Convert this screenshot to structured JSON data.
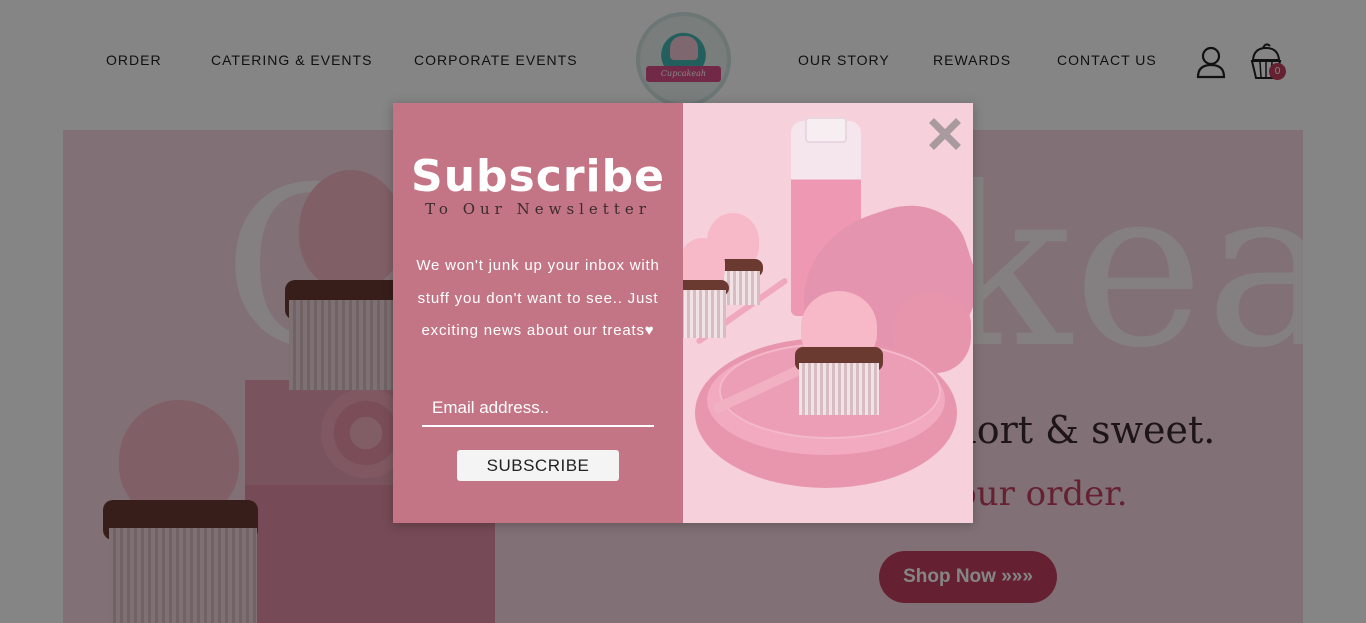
{
  "nav": {
    "left": [
      "ORDER",
      "CATERING & EVENTS",
      "CORPORATE EVENTS"
    ],
    "right": [
      "OUR STORY",
      "REWARDS",
      "CONTACT US"
    ]
  },
  "logo": {
    "ribbon_text": "Cupcakeah"
  },
  "cart": {
    "count": "0"
  },
  "hero": {
    "bg_text": "Cupcakeah",
    "tagline": "Life is short & sweet.",
    "subline": "Place your order.",
    "cta_label": "Shop Now »»»"
  },
  "modal": {
    "title": "Subscribe",
    "subtitle": "To Our Newsletter",
    "body": "We won't junk up your inbox with stuff you don't want to see.. Just exciting news about our treats♥",
    "email_placeholder": "Email address..",
    "button_label": "SUBSCRIBE"
  },
  "colors": {
    "accent": "#c2405e",
    "modal_panel": "#c47585",
    "overlay": "rgba(0,0,0,0.48)"
  },
  "icons": [
    "user-icon",
    "cart-icon",
    "close-icon"
  ]
}
